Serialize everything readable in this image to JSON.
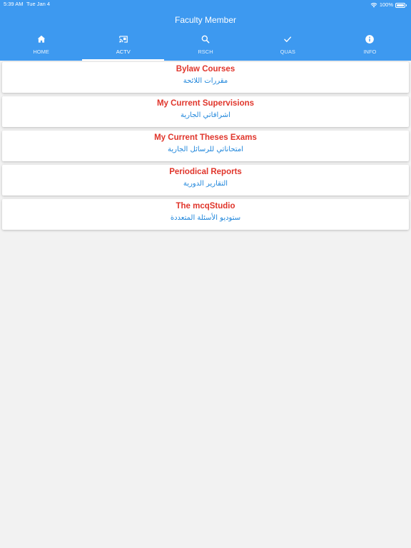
{
  "status_bar": {
    "time": "5:39 AM",
    "date": "Tue Jan 4",
    "battery": "100%",
    "wifi_icon": "wifi-icon",
    "battery_icon": "battery-icon"
  },
  "header": {
    "title": "Faculty Member",
    "background_color": "#3d99f0"
  },
  "tabs": [
    {
      "label": "HOME",
      "icon": "home-icon",
      "active": false
    },
    {
      "label": "ACTV",
      "icon": "cast-icon",
      "active": true
    },
    {
      "label": "RSCH",
      "icon": "search-icon",
      "active": false
    },
    {
      "label": "QUAS",
      "icon": "check-icon",
      "active": false
    },
    {
      "label": "INFO",
      "icon": "info-icon",
      "active": false
    }
  ],
  "menu": {
    "items": [
      {
        "title": "Bylaw Courses",
        "subtitle": "مقررات اللائحة"
      },
      {
        "title": "My Current Supervisions",
        "subtitle": "اشرافاتي الجارية"
      },
      {
        "title": "My Current Theses Exams",
        "subtitle": "امتحاناتي للرسائل الجارية"
      },
      {
        "title": "Periodical Reports",
        "subtitle": "التقارير الدورية"
      },
      {
        "title": "The mcqStudio",
        "subtitle": "ستوديو الأسئلة المتعددة"
      }
    ],
    "title_color": "#e0352b",
    "subtitle_color": "#1f86db"
  }
}
